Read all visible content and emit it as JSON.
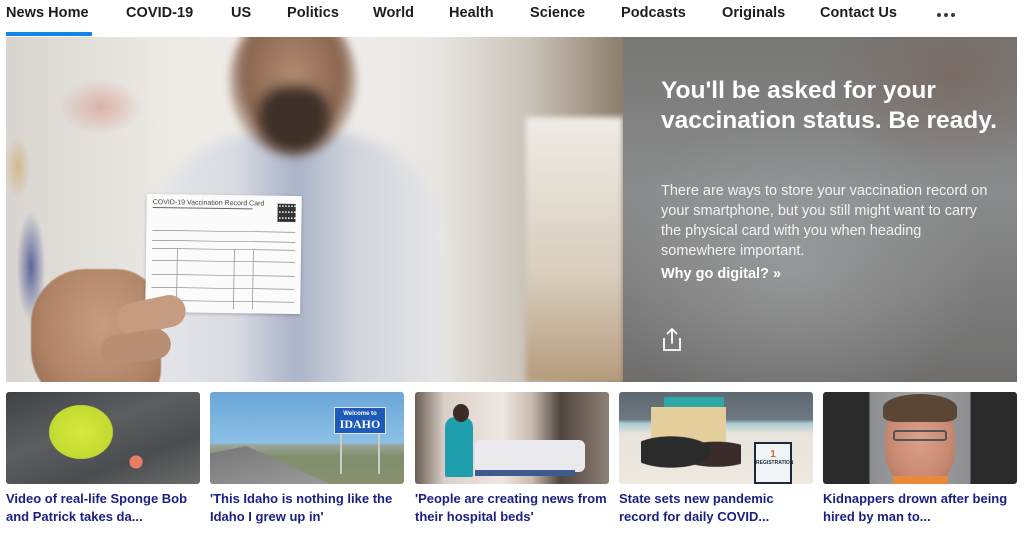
{
  "nav": {
    "items": [
      {
        "label": "News Home",
        "active": true
      },
      {
        "label": "COVID-19",
        "active": false
      },
      {
        "label": "US",
        "active": false
      },
      {
        "label": "Politics",
        "active": false
      },
      {
        "label": "World",
        "active": false
      },
      {
        "label": "Health",
        "active": false
      },
      {
        "label": "Science",
        "active": false
      },
      {
        "label": "Podcasts",
        "active": false
      },
      {
        "label": "Originals",
        "active": false
      },
      {
        "label": "Contact Us",
        "active": false
      }
    ],
    "more_icon": "ellipsis-icon",
    "active_color": "#0f86ec"
  },
  "hero": {
    "image_card_text": "COVID-19 Vaccination Record Card",
    "title": "You'll be asked for your vaccination status. Be ready.",
    "description": "There are ways to store your vaccination record on your smartphone, but you still might want to carry the physical card with you when heading somewhere important.",
    "link_label": "Why go digital? »",
    "share_icon": "share-icon"
  },
  "thumbs": [
    {
      "title": "Video of real-life Sponge Bob and Patrick takes da..."
    },
    {
      "title": "'This Idaho is nothing like the Idaho I grew up in'",
      "sign_top": "Welcome to",
      "sign_main": "IDAHO"
    },
    {
      "title": "'People are creating news from their hospital beds'"
    },
    {
      "title": "State sets new pandemic record for daily COVID...",
      "sign_number": "1",
      "sign_text": "REGISTRATION"
    },
    {
      "title": "Kidnappers drown after being hired by man to..."
    }
  ],
  "colors": {
    "headline_link": "#1a1f83",
    "nav_text": "#1d1d1f"
  }
}
